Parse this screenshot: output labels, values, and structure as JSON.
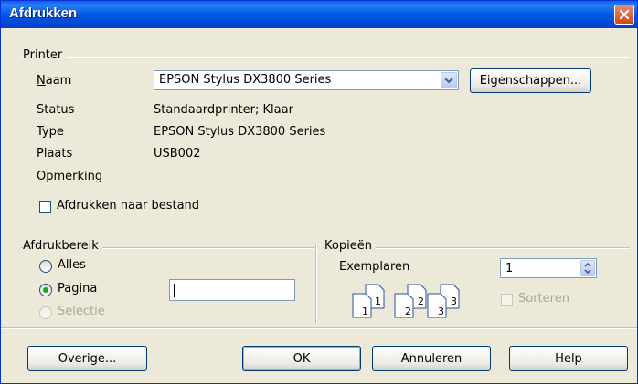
{
  "window": {
    "title": "Afdrukken"
  },
  "printer": {
    "group_label": "Printer",
    "name_label": "Naam",
    "name_value": "EPSON Stylus DX3800 Series",
    "properties_button": "Eigenschappen...",
    "status_label": "Status",
    "status_value": "Standaardprinter; Klaar",
    "type_label": "Type",
    "type_value": "EPSON Stylus DX3800 Series",
    "location_label": "Plaats",
    "location_value": "USB002",
    "comment_label": "Opmerking",
    "comment_value": "",
    "print_to_file_label": "Afdrukken naar bestand",
    "print_to_file_checked": false
  },
  "print_range": {
    "group_label": "Afdrukbereik",
    "all_label": "Alles",
    "pages_label": "Pagina",
    "selection_label": "Selectie",
    "selected": "Pagina",
    "pages_value": ""
  },
  "copies": {
    "group_label": "Kopieën",
    "copies_label": "Exemplaren",
    "copies_value": "1",
    "collate_label": "Sorteren",
    "collate_checked": false,
    "page_icons": [
      "1",
      "1",
      "2",
      "2",
      "3",
      "3"
    ]
  },
  "buttons": {
    "more": "Overige...",
    "ok": "OK",
    "cancel": "Annuleren",
    "help": "Help"
  },
  "colors": {
    "titlebar": "#0058e6",
    "dialog_bg": "#ece9d8",
    "radio_dot": "#21a121"
  }
}
